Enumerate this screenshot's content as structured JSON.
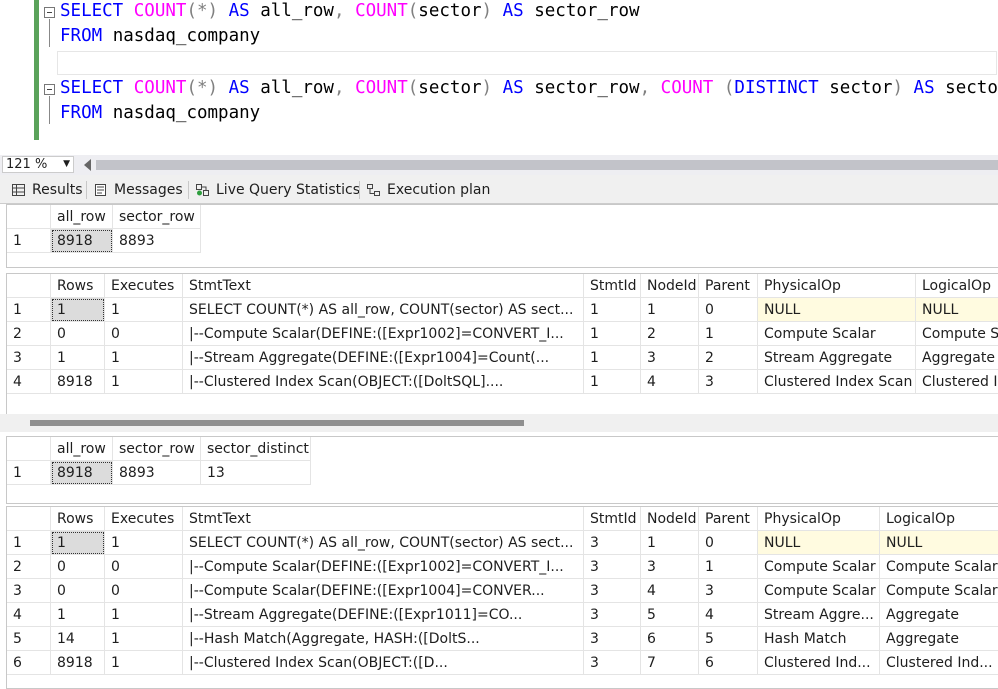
{
  "editor": {
    "lines": [
      {
        "parts": [
          [
            "kw",
            "SELECT "
          ],
          [
            "fn",
            "COUNT"
          ],
          [
            "gr",
            "(*)"
          ],
          [
            "kw",
            " AS "
          ],
          [
            "tx",
            "all_row"
          ],
          [
            "gr",
            ", "
          ],
          [
            "fn",
            "COUNT"
          ],
          [
            "gr",
            "("
          ],
          [
            "tx",
            "sector"
          ],
          [
            "gr",
            ")"
          ],
          [
            "kw",
            " AS "
          ],
          [
            "tx",
            "sector_row"
          ]
        ]
      },
      {
        "parts": [
          [
            "kw",
            "FROM "
          ],
          [
            "tx",
            "nasdaq_company"
          ]
        ]
      },
      {
        "parts": []
      },
      {
        "parts": [
          [
            "kw",
            "SELECT "
          ],
          [
            "fn",
            "COUNT"
          ],
          [
            "gr",
            "(*)"
          ],
          [
            "kw",
            " AS "
          ],
          [
            "tx",
            "all_row"
          ],
          [
            "gr",
            ", "
          ],
          [
            "fn",
            "COUNT"
          ],
          [
            "gr",
            "("
          ],
          [
            "tx",
            "sector"
          ],
          [
            "gr",
            ")"
          ],
          [
            "kw",
            " AS "
          ],
          [
            "tx",
            "sector_row"
          ],
          [
            "gr",
            ", "
          ],
          [
            "fn",
            "COUNT"
          ],
          [
            "gr",
            " ("
          ],
          [
            "kw",
            "DISTINCT "
          ],
          [
            "tx",
            "sector"
          ],
          [
            "gr",
            ")"
          ],
          [
            "kw",
            " AS "
          ],
          [
            "tx",
            "sector_distinct"
          ]
        ]
      },
      {
        "parts": [
          [
            "kw",
            "FROM "
          ],
          [
            "tx",
            "nasdaq_company"
          ]
        ]
      }
    ]
  },
  "zoom": {
    "value": "121 %"
  },
  "tabs": [
    {
      "label": "Results",
      "icon": "grid-icon"
    },
    {
      "label": "Messages",
      "icon": "messages-icon"
    },
    {
      "label": "Live Query Statistics",
      "icon": "live-stats-icon"
    },
    {
      "label": "Execution plan",
      "icon": "execution-plan-icon"
    }
  ],
  "grid1": {
    "columns": [
      "all_row",
      "sector_row"
    ],
    "rows": [
      [
        "1",
        "8918",
        "8893"
      ]
    ]
  },
  "grid2": {
    "columns": [
      "Rows",
      "Executes",
      "StmtText",
      "StmtId",
      "NodeId",
      "Parent",
      "PhysicalOp",
      "LogicalOp"
    ],
    "rows": [
      [
        "1",
        "1",
        "1",
        "SELECT COUNT(*) AS all_row, COUNT(sector) AS sect...",
        "1",
        "1",
        "0",
        "NULL",
        "NULL"
      ],
      [
        "2",
        "0",
        "0",
        "  |--Compute Scalar(DEFINE:([Expr1002]=CONVERT_I...",
        "1",
        "2",
        "1",
        "Compute Scalar",
        "Compute Scalar"
      ],
      [
        "3",
        "1",
        "1",
        "       |--Stream Aggregate(DEFINE:([Expr1004]=Count(...",
        "1",
        "3",
        "2",
        "Stream Aggregate",
        "Aggregate"
      ],
      [
        "4",
        "8918",
        "1",
        "            |--Clustered Index Scan(OBJECT:([DoltSQL]....",
        "1",
        "4",
        "3",
        "Clustered Index Scan",
        "Clustered Index Scan"
      ]
    ]
  },
  "grid3": {
    "columns": [
      "all_row",
      "sector_row",
      "sector_distinct"
    ],
    "rows": [
      [
        "1",
        "8918",
        "8893",
        "13"
      ]
    ]
  },
  "grid4": {
    "columns": [
      "Rows",
      "Executes",
      "StmtText",
      "StmtId",
      "NodeId",
      "Parent",
      "PhysicalOp",
      "LogicalOp"
    ],
    "rows": [
      [
        "1",
        "1",
        "1",
        "SELECT COUNT(*) AS all_row, COUNT(sector) AS sect...",
        "3",
        "1",
        "0",
        "NULL",
        "NULL"
      ],
      [
        "2",
        "0",
        "0",
        "  |--Compute Scalar(DEFINE:([Expr1002]=CONVERT_I...",
        "3",
        "3",
        "1",
        "Compute Scalar",
        "Compute Scalar"
      ],
      [
        "3",
        "0",
        "0",
        "       |--Compute Scalar(DEFINE:([Expr1004]=CONVER...",
        "3",
        "4",
        "3",
        "Compute Scalar",
        "Compute Scalar"
      ],
      [
        "4",
        "1",
        "1",
        "            |--Stream Aggregate(DEFINE:([Expr1011]=CO...",
        "3",
        "5",
        "4",
        "Stream Aggre...",
        "Aggregate"
      ],
      [
        "5",
        "14",
        "1",
        "                  |--Hash Match(Aggregate, HASH:([DoltS...",
        "3",
        "6",
        "5",
        "Hash Match",
        "Aggregate"
      ],
      [
        "6",
        "8918",
        "1",
        "                       |--Clustered Index Scan(OBJECT:([D...",
        "3",
        "7",
        "6",
        "Clustered Ind...",
        "Clustered Ind..."
      ]
    ]
  }
}
